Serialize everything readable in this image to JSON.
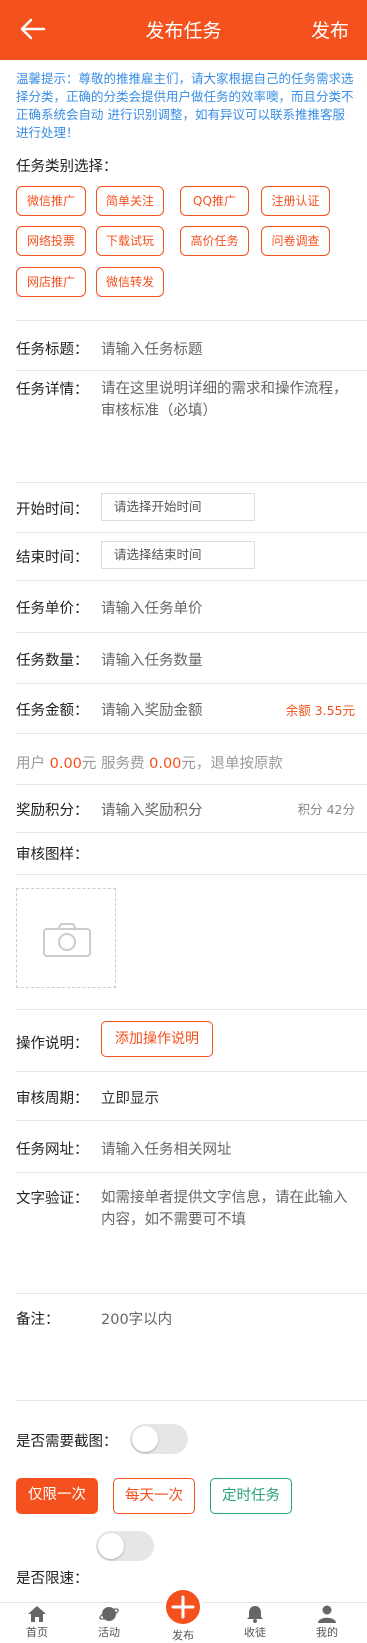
{
  "header": {
    "title": "发布任务",
    "publish_label": "发布"
  },
  "tip": "温馨提示：尊敬的推推雇主们，请大家根据自己的任务需求选择分类，正确的分类会提供用户做任务的效率噢，而且分类不正确系统会自动 进行识别调整，如有异议可以联系推推客服进行处理！",
  "category": {
    "label": "任务类别选择：",
    "items": [
      "微信推广",
      "简单关注",
      "QQ推广",
      "注册认证",
      "网络投票",
      "下载试玩",
      "高价任务",
      "问卷调查",
      "网店推广",
      "微信转发"
    ]
  },
  "form": {
    "task_title": {
      "label": "任务标题：",
      "placeholder": "请输入任务标题"
    },
    "task_detail": {
      "label": "任务详情：",
      "placeholder": "请在这里说明详细的需求和操作流程，审核标准（必填）"
    },
    "start_time": {
      "label": "开始时间：",
      "placeholder": "请选择开始时间"
    },
    "end_time": {
      "label": "结束时间：",
      "placeholder": "请选择结束时间"
    },
    "unit_price": {
      "label": "任务单价：",
      "placeholder": "请输入任务单价"
    },
    "quantity": {
      "label": "任务数量：",
      "placeholder": "请输入任务数量"
    },
    "amount": {
      "label": "任务金额：",
      "placeholder": "请输入奖励金额",
      "balance": "余额 3.55元"
    },
    "fee": {
      "user_prefix": "用户",
      "user_value": "0.00",
      "yuan1": "元",
      "fee_prefix": " 服务费 ",
      "fee_value": "0.00",
      "suffix": "元，退单按原款"
    },
    "points": {
      "label": "奖励积分：",
      "placeholder": "请输入奖励积分",
      "available": "积分 42分"
    },
    "review_sample": {
      "label": "审核图样："
    },
    "operation": {
      "label": "操作说明：",
      "button": "添加操作说明"
    },
    "review_period": {
      "label": "审核周期：",
      "value": "立即显示"
    },
    "task_url": {
      "label": "任务网址：",
      "placeholder": "请输入任务相关网址"
    },
    "text_verify": {
      "label": "文字验证：",
      "placeholder": "如需接单者提供文字信息，请在此输入内容，如不需要可不填"
    },
    "remark": {
      "label": "备注：",
      "placeholder": "200字以内"
    },
    "need_screenshot": {
      "label": "是否需要截图：",
      "on": false
    },
    "frequency": {
      "options": [
        "仅限一次",
        "每天一次",
        "定时任务"
      ],
      "selected": "仅限一次"
    },
    "speed_limit": {
      "label": "是否限速：",
      "on": false
    }
  },
  "tabbar": {
    "items": [
      "首页",
      "活动",
      "发布",
      "收徒",
      "我的"
    ]
  },
  "colors": {
    "accent": "#f4511e",
    "tip_blue": "#3a8ee6",
    "green": "#26a17b"
  }
}
